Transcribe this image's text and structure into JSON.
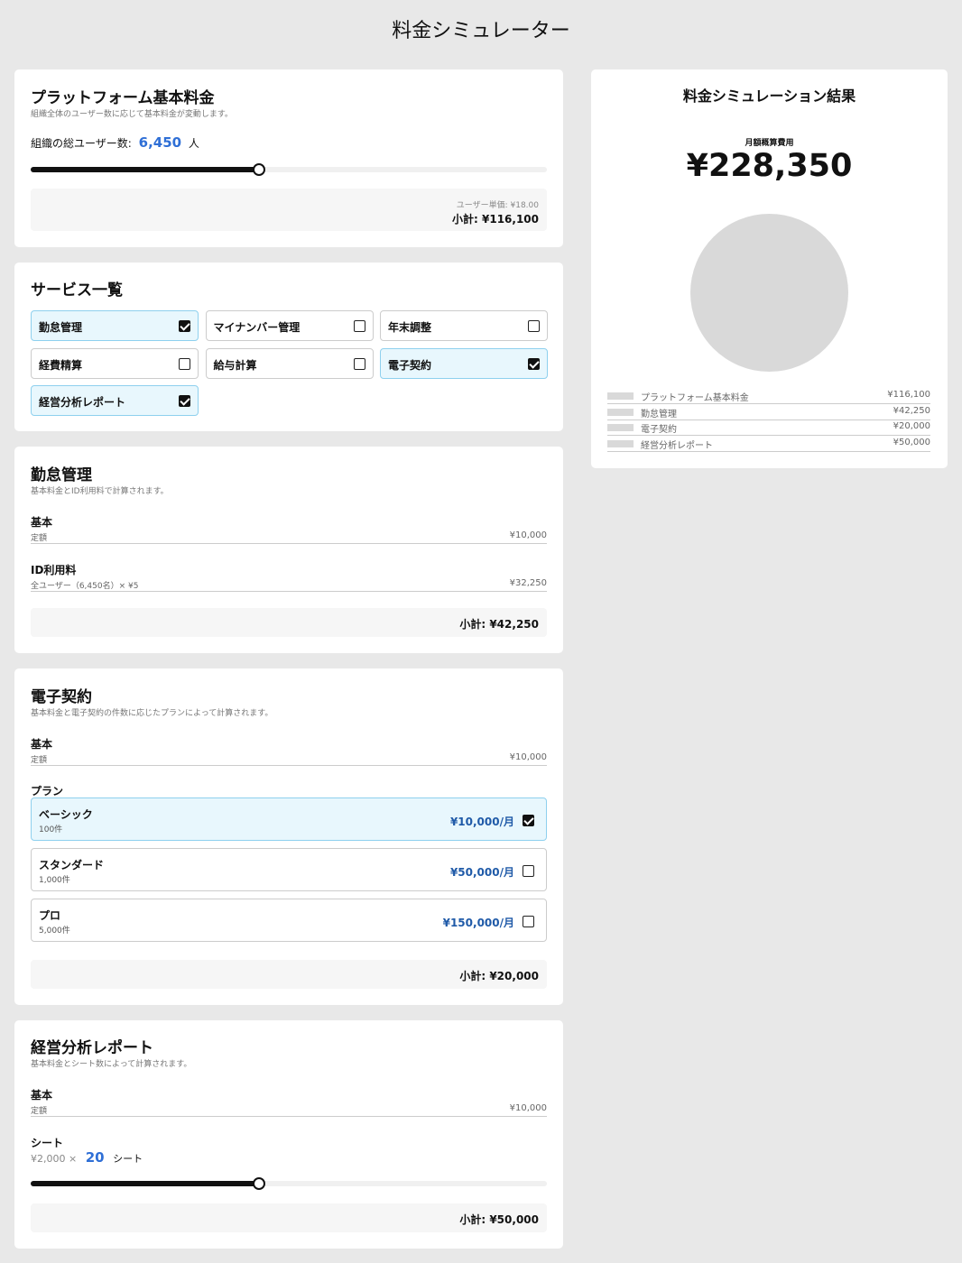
{
  "page_title": "料金シミュレーター",
  "platform": {
    "title": "プラットフォーム基本料金",
    "description": "組織全体のユーザー数に応じて基本料金が変動します。",
    "users_label": "組織の総ユーザー数:",
    "users_value": "6,450",
    "users_unit": "人",
    "slider_fraction": 0.442,
    "unit_price": "ユーザー単価: ¥18.00",
    "subtotal": "小計: ¥116,100"
  },
  "services": {
    "title": "サービス一覧",
    "items": [
      {
        "label": "勤怠管理",
        "checked": true
      },
      {
        "label": "マイナンバー管理",
        "checked": false
      },
      {
        "label": "年末調整",
        "checked": false
      },
      {
        "label": "経費精算",
        "checked": false
      },
      {
        "label": "給与計算",
        "checked": false
      },
      {
        "label": "電子契約",
        "checked": true
      },
      {
        "label": "経営分析レポート",
        "checked": true
      }
    ]
  },
  "attendance": {
    "title": "勤怠管理",
    "description": "基本料金とID利用料で計算されます。",
    "base_title": "基本",
    "base_sub": "定額",
    "base_value": "¥10,000",
    "id_title": "ID利用料",
    "id_sub": "全ユーザー（6,450名）× ¥5",
    "id_value": "¥32,250",
    "subtotal": "小計: ¥42,250"
  },
  "esign": {
    "title": "電子契約",
    "description": "基本料金と電子契約の件数に応じたプランによって計算されます。",
    "base_title": "基本",
    "base_sub": "定額",
    "base_value": "¥10,000",
    "plan_label": "プラン",
    "plans": [
      {
        "name": "ベーシック",
        "count": "100件",
        "price": "¥10,000/月",
        "checked": true
      },
      {
        "name": "スタンダード",
        "count": "1,000件",
        "price": "¥50,000/月",
        "checked": false
      },
      {
        "name": "プロ",
        "count": "5,000件",
        "price": "¥150,000/月",
        "checked": false
      }
    ],
    "subtotal": "小計: ¥20,000"
  },
  "report": {
    "title": "経営分析レポート",
    "description": "基本料金とシート数によって計算されます。",
    "base_title": "基本",
    "base_sub": "定額",
    "base_value": "¥10,000",
    "sheet_title": "シート",
    "sheet_prefix": "¥2,000 ×",
    "sheet_value": "20",
    "sheet_unit": "シート",
    "slider_fraction": 0.442,
    "subtotal": "小計: ¥50,000"
  },
  "result": {
    "title": "料金シミュレーション結果",
    "monthly_label": "月額概算費用",
    "monthly_total": "¥228,350",
    "pie_color": "#d9d9d9",
    "breakdown": [
      {
        "name": "プラットフォーム基本料金",
        "value": "¥116,100"
      },
      {
        "name": "勤怠管理",
        "value": "¥42,250"
      },
      {
        "name": "電子契約",
        "value": "¥20,000"
      },
      {
        "name": "経営分析レポート",
        "value": "¥50,000"
      }
    ]
  }
}
